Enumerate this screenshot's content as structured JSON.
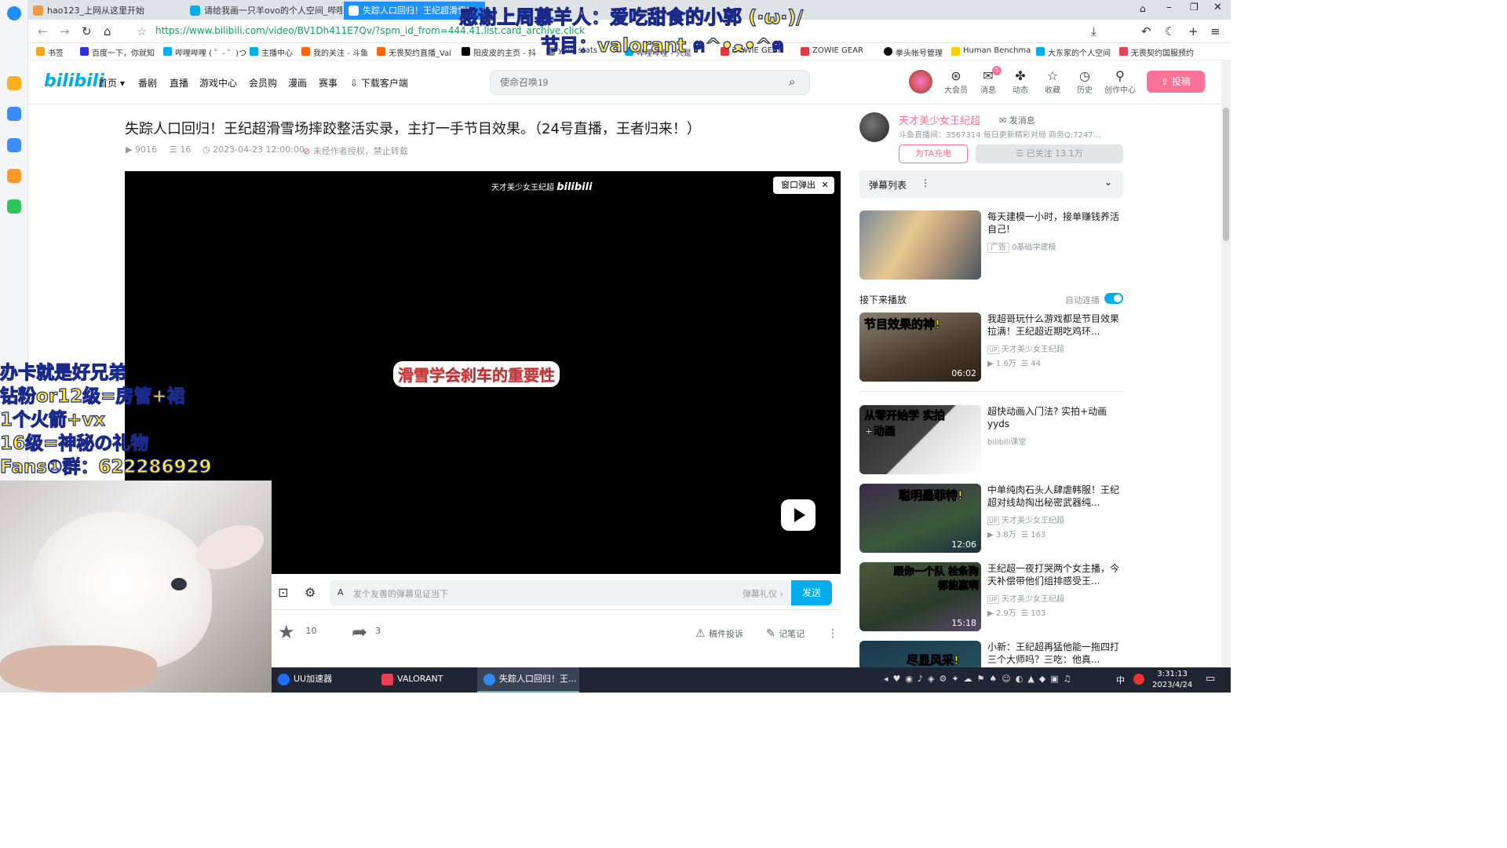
{
  "tabs": [
    {
      "label": "hao123_上网从这里开始",
      "active": false
    },
    {
      "label": "请给我画一只羊ovo的个人空间_哔哩",
      "active": false
    },
    {
      "label": "失踪人口回归！王纪超滑雪场",
      "active": true
    }
  ],
  "address": {
    "url": "https://www.bilibili.com/video/BV1Dh411E7Qv/?spm_id_from=444.41.list.card_archive.click"
  },
  "bookmarks": [
    "书签",
    "百度一下，你就知",
    "哔哩哔哩 ( ゜- ゜)つ",
    "主播中心",
    "我的关注 - 斗鱼",
    "无畏契约直播_Val",
    "阳皮皮的主页 - 抖",
    "your stats",
    "哔哩哔哩 - 只是",
    "ZOWIE GEAR",
    "ZOWIE GEAR",
    "拳头帐号管理",
    "Human Benchma",
    "大东家的个人空间",
    "无畏契约国服预约"
  ],
  "header": {
    "logo": "bilibili",
    "nav": [
      "首页 ▾",
      "番剧",
      "直播",
      "游戏中心",
      "会员购",
      "漫画",
      "赛事",
      "下载客户端"
    ],
    "search_placeholder": "使命召唤19",
    "right_icons": [
      {
        "label": "大会员",
        "icon": "vip-icon"
      },
      {
        "label": "消息",
        "icon": "message-icon",
        "badge": "1"
      },
      {
        "label": "动态",
        "icon": "dynamic-icon"
      },
      {
        "label": "收藏",
        "icon": "star-icon"
      },
      {
        "label": "历史",
        "icon": "history-icon"
      },
      {
        "label": "创作中心",
        "icon": "bulb-icon"
      }
    ],
    "upload_label": "投稿"
  },
  "video": {
    "title": "失踪人口回归！王纪超滑雪场摔跤整活实录，主打一手节目效果。（24号直播，王者归来！）",
    "views": "9016",
    "danmaku": "16",
    "date": "2023-04-23 12:00:00",
    "copyright": "未经作者授权，禁止转载",
    "watermark": "天才美少女王纪超",
    "watermark_logo": "bilibili",
    "popout_label": "窗口弹出",
    "subtitle": "滑雪学会刹车的重要性",
    "dm_placeholder": "发个友善的弹幕见证当下",
    "dm_etiquette": "弹幕礼仪 ›",
    "send_label": "发送",
    "likes": "10",
    "shares": "3",
    "report_label": "稿件投诉",
    "notes_label": "记笔记"
  },
  "overlay": {
    "top_lines": [
      "感谢上周慕羊人：爱吃甜食的小郭 (·ω·)/",
      "节目：valorant ฅ^•ﻌ•^ฅ"
    ],
    "left_lines": [
      "办卡就是好兄弟",
      "钻粉or12级=房管+裙",
      "1个火箭+vx",
      "16级=神秘の礼物",
      "Fans①群：622286929"
    ]
  },
  "uploader": {
    "name": "天才美少女王纪超",
    "message_label": "发消息",
    "desc": "斗鱼直播间：3567314 每日更新精彩对局 商务Q:7247...",
    "charge_label": "为TA充电",
    "follow_label": "☰ 已关注 13.1万"
  },
  "dm_list_label": "弹幕列表",
  "ad": {
    "title": "每天建模一小时，接单赚钱养活自己!",
    "tag": "广告",
    "source": "0基础学建模"
  },
  "autoplay": {
    "label": "接下来播放",
    "toggle_label": "自动连播"
  },
  "recs": [
    {
      "title": "我超哥玩什么游戏都是节目效果拉满！王纪超近期吃鸡环...",
      "up": "天才美少女王纪超",
      "views": "1.6万",
      "dm": "44",
      "duration": "06:02",
      "cap": "节目效果的神!",
      "bg": "#6b5a4a"
    },
    {
      "title": "超快动画入门法? 实拍+动画yyds",
      "up": "bilibili课堂",
      "views": "",
      "dm": "",
      "duration": "",
      "cap": "从零开始学 实拍+动画",
      "bg": "#2b2b2b"
    },
    {
      "title": "中单纯肉石头人肆虐韩服！王纪超对线劫掏出秘密武器纯...",
      "up": "天才美少女王纪超",
      "views": "3.8万",
      "dm": "163",
      "duration": "12:06",
      "cap": "聪明墨菲特!",
      "bg": "#3b5a3a"
    },
    {
      "title": "王纪超一夜打哭两个女主播，今天补偿带他们组排感受王...",
      "up": "天才美少女王纪超",
      "views": "2.9万",
      "dm": "103",
      "duration": "15:18",
      "cap": "跟你一个队 栓条狗都能赢啊",
      "bg": "#4a5a3a"
    },
    {
      "title": "小新：王纪超再猛他能一拖四打三个大师吗？三吃：他真...",
      "up": "",
      "views": "",
      "dm": "",
      "duration": "",
      "cap": "尽显风采!",
      "bg": "#1a3a4a"
    }
  ],
  "taskbar": {
    "apps": [
      {
        "label": "UU加速器",
        "color": "#1e6fff"
      },
      {
        "label": "VALORANT",
        "color": "#e84057"
      },
      {
        "label": "失踪人口回归！王...",
        "color": "#2d8cf0"
      }
    ],
    "time": "3:31:13",
    "date": "2023/4/24",
    "ime": "中"
  }
}
